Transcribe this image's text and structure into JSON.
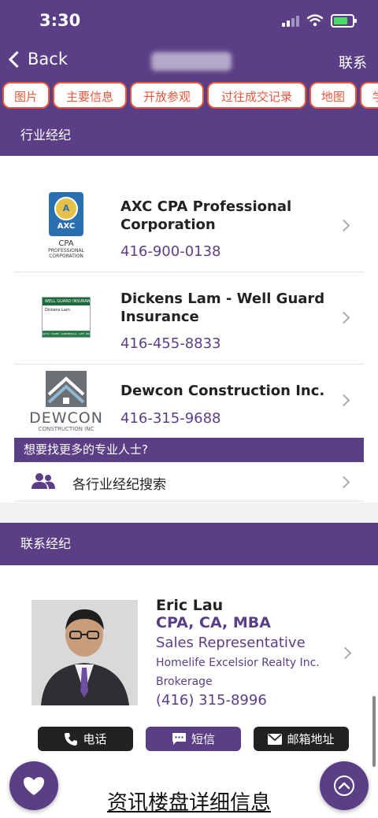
{
  "status_bar": {
    "time": "3:30"
  },
  "header": {
    "back_label": "Back",
    "contact_label": "联系"
  },
  "tabs": [
    "图片",
    "主要信息",
    "开放参观",
    "过往成交记录",
    "地图",
    "学"
  ],
  "pros_section": {
    "title": "行业经纪"
  },
  "professionals": [
    {
      "name": "AXC CPA Professional Corporation",
      "phone": "416-900-0138",
      "logo_text": {
        "badge": "AXC",
        "sub1": "CPA",
        "sub2": "PROFESSIONAL",
        "sub3": "CORPORATION"
      }
    },
    {
      "name": "Dickens Lam - Well Guard Insurance",
      "phone": "416-455-8833",
      "logo_text": {
        "line1": "WELL GUARD INSURANCE",
        "line2": "Dickens Lam",
        "line3": "AUTO · HOME · COMMERCIAL · LIFE · RRSP"
      }
    },
    {
      "name": "Dewcon Construction Inc.",
      "phone": "416-315-9688",
      "logo_text": {
        "line1": "DEWCON",
        "line2": "CONSTRUCTION INC"
      }
    }
  ],
  "more_pros": {
    "banner": "想要找更多的专业人士?",
    "search_label": "各行业经纪搜索"
  },
  "agent_section": {
    "title": "联系经纪"
  },
  "agent": {
    "name": "Eric Lau",
    "credentials": "CPA, CA, MBA",
    "role": "Sales Representative",
    "company": "Homelife Excelsior Realty Inc.",
    "brokerage": "Brokerage",
    "phone": "(416) 315-8996"
  },
  "actions": {
    "call": "电话",
    "sms": "短信",
    "email": "邮箱地址"
  },
  "bottom": {
    "title": "资讯楼盘详细信息"
  },
  "colors": {
    "primary": "#5a3f86",
    "tab_accent": "#e8583c",
    "dark_button": "#222222"
  }
}
